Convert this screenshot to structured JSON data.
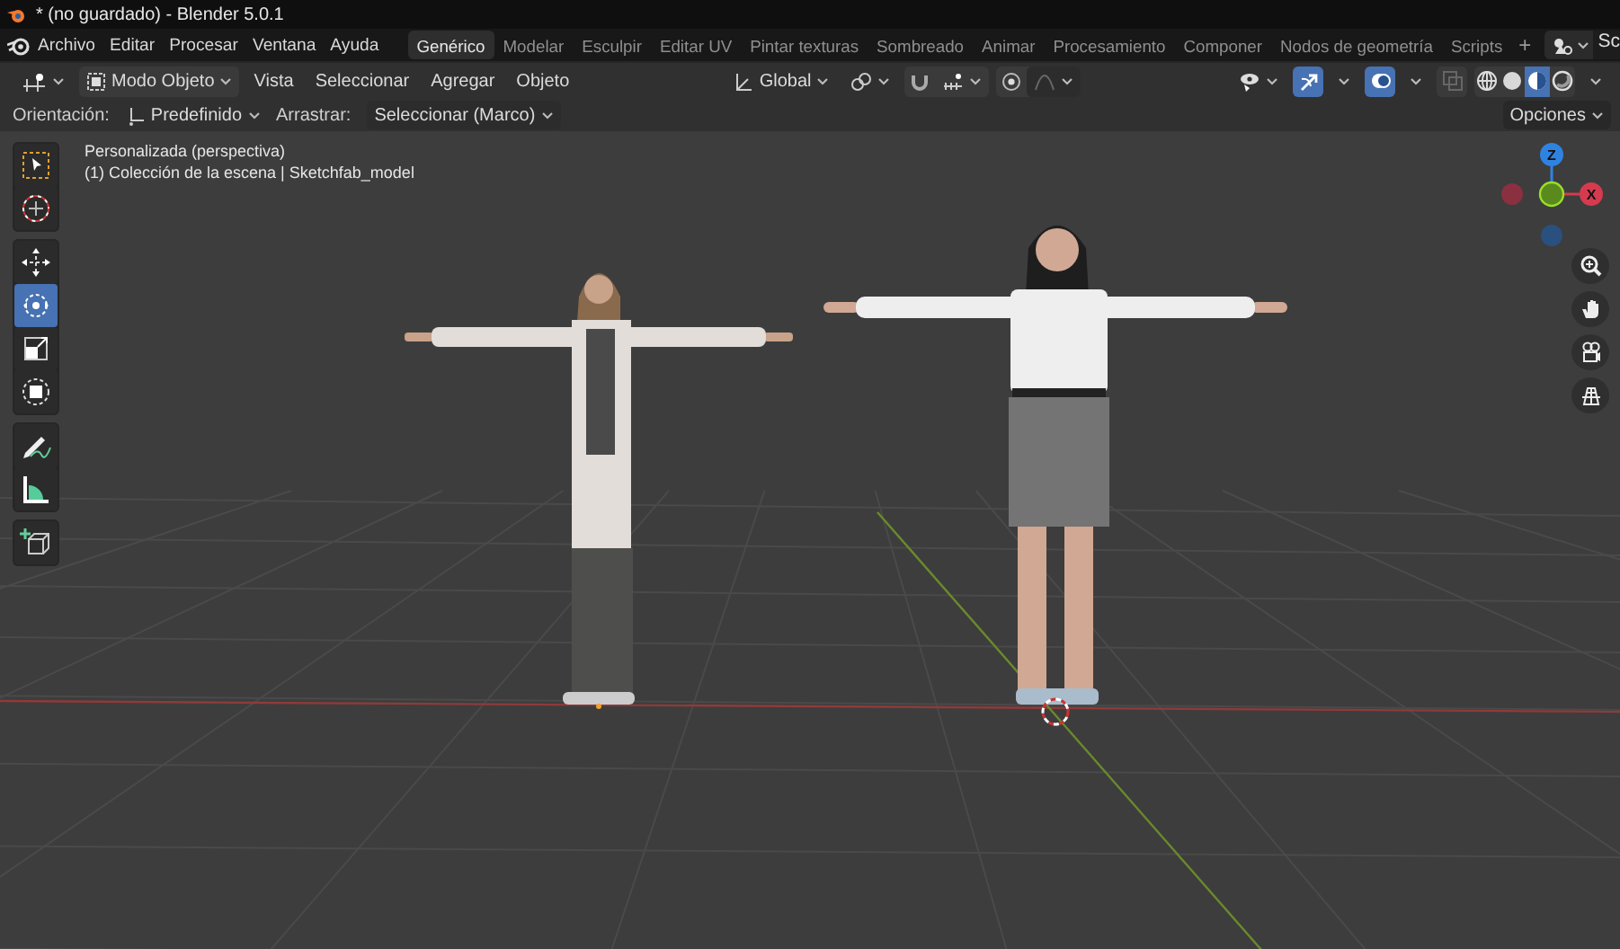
{
  "window": {
    "title": "* (no guardado) - Blender 5.0.1"
  },
  "menu": [
    "Archivo",
    "Editar",
    "Procesar",
    "Ventana",
    "Ayuda"
  ],
  "workspaces": [
    {
      "label": "Genérico",
      "selected": true
    },
    {
      "label": "Modelar",
      "selected": false
    },
    {
      "label": "Esculpir",
      "selected": false
    },
    {
      "label": "Editar UV",
      "selected": false
    },
    {
      "label": "Pintar texturas",
      "selected": false
    },
    {
      "label": "Sombreado",
      "selected": false
    },
    {
      "label": "Animar",
      "selected": false
    },
    {
      "label": "Procesamiento",
      "selected": false
    },
    {
      "label": "Componer",
      "selected": false
    },
    {
      "label": "Nodos de geometría",
      "selected": false
    },
    {
      "label": "Scripts",
      "selected": false
    }
  ],
  "add_workspace": "+",
  "scene": "Sc",
  "header": {
    "mode": "Modo Objeto",
    "menus": [
      "Vista",
      "Seleccionar",
      "Agregar",
      "Objeto"
    ],
    "orientation": "Global",
    "viewport_toggles": [
      {
        "kind": "gizmo",
        "on": true
      },
      {
        "kind": "overlay",
        "on": true
      },
      {
        "kind": "xray",
        "on": false
      }
    ],
    "shading": [
      {
        "kind": "wireframe",
        "selected": false
      },
      {
        "kind": "solid",
        "selected": false
      },
      {
        "kind": "material",
        "selected": true
      },
      {
        "kind": "rendered",
        "selected": false
      }
    ]
  },
  "tool_settings": {
    "orientation_label": "Orientación:",
    "orientation": "Predefinido",
    "drag_label": "Arrastrar:",
    "drag": "Seleccionar (Marco)",
    "options": "Opciones"
  },
  "viewport": {
    "view_name": "Personalizada (perspectiva)",
    "collection": "(1) Colección de la escena | Sketchfab_model",
    "gizmo_labels": [
      "Z",
      "X"
    ]
  },
  "tool_groups": [
    [
      {
        "kind": "select",
        "selected": false
      },
      {
        "kind": "cursor",
        "selected": false
      }
    ],
    [
      {
        "kind": "move",
        "selected": false
      },
      {
        "kind": "rotate",
        "selected": true
      },
      {
        "kind": "scale",
        "selected": false
      },
      {
        "kind": "transform",
        "selected": false
      }
    ],
    [
      {
        "kind": "annotate",
        "selected": false
      },
      {
        "kind": "measure",
        "selected": false
      }
    ],
    [
      {
        "kind": "add-cube",
        "selected": false
      }
    ]
  ]
}
